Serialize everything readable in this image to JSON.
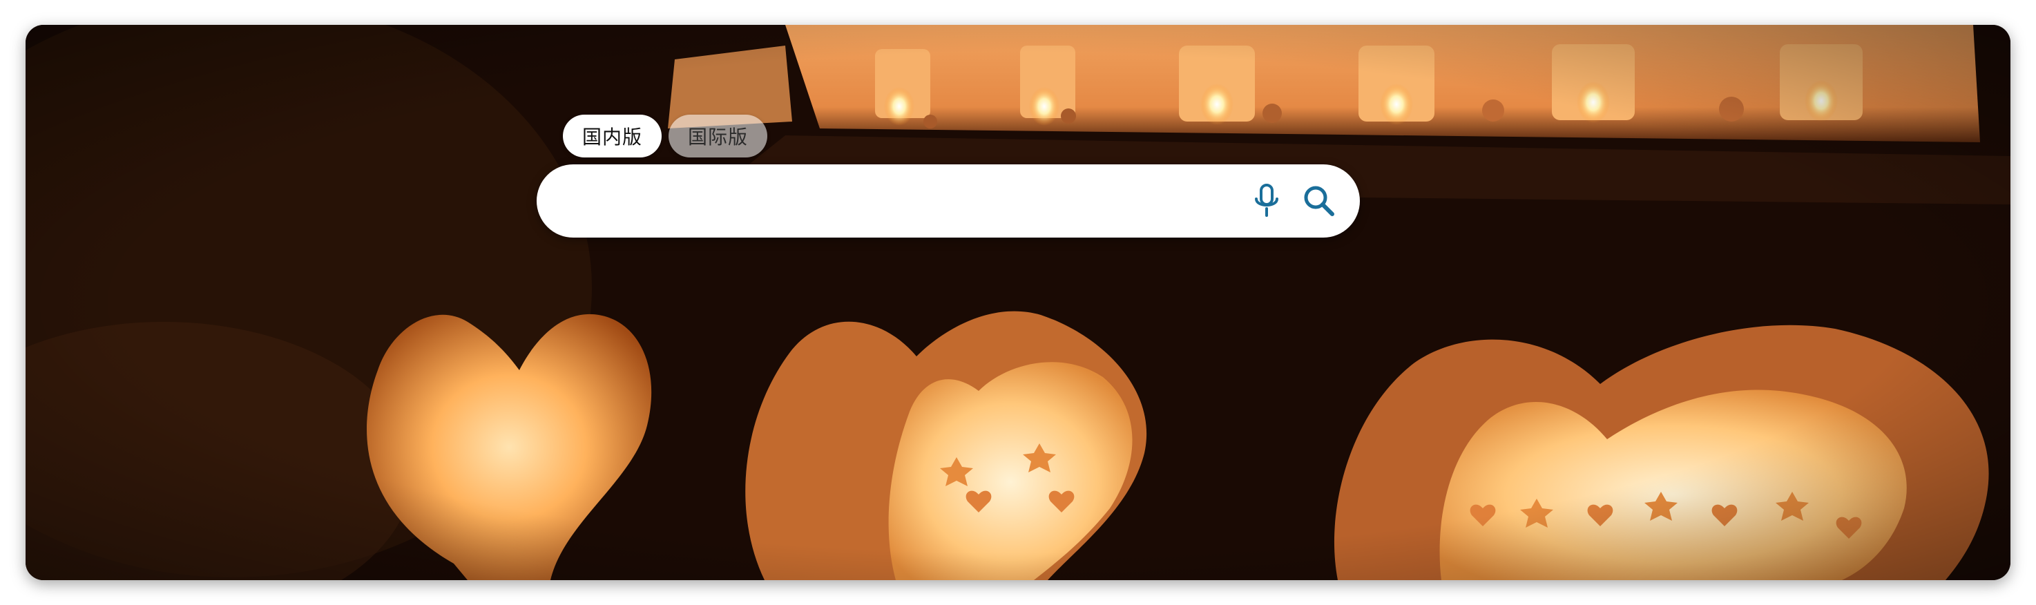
{
  "tabs": [
    {
      "label": "国内版",
      "active": true
    },
    {
      "label": "国际版",
      "active": false
    }
  ],
  "search": {
    "value": "",
    "placeholder": ""
  },
  "icons": {
    "voice": "microphone-icon",
    "search": "magnifier-icon"
  },
  "colors": {
    "icon_accent": "#1a6e9a",
    "search_bar_bg": "#ffffff",
    "tab_active_bg": "#ffffff"
  }
}
